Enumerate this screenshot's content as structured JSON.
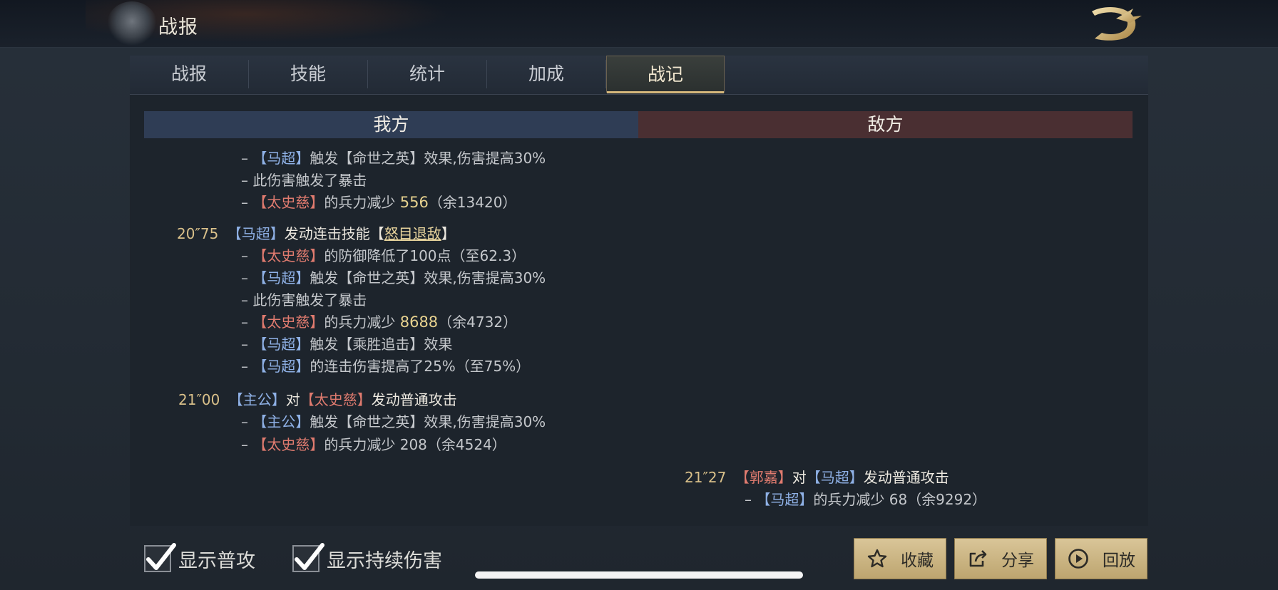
{
  "window": {
    "title": "战报"
  },
  "tabs": [
    {
      "label": "战报",
      "active": false
    },
    {
      "label": "技能",
      "active": false
    },
    {
      "label": "统计",
      "active": false
    },
    {
      "label": "加成",
      "active": false
    },
    {
      "label": "战记",
      "active": true
    }
  ],
  "sides": {
    "ours": "我方",
    "enemy": "敌方"
  },
  "log": {
    "partial": {
      "l1": {
        "dash": "–",
        "b1": "【马超】",
        "t1": "触发【命世之英】效果,伤害提高30%"
      },
      "l2": {
        "text": "– 此伤害触发了暴击"
      },
      "l3": {
        "dash": "–",
        "r1": "【太史慈】",
        "t1": "的兵力减少",
        "num": "556",
        "t2": "（余13420）"
      }
    },
    "e1": {
      "time": "20″75",
      "actor": "【马超】",
      "t1": "发动连击技能【",
      "skill": "怒目退敌",
      "t2": "】",
      "l1": {
        "dash": "–",
        "r1": "【太史慈】",
        "t1": "的防御降低了100点（至62.3）"
      },
      "l2": {
        "dash": "–",
        "b1": "【马超】",
        "t1": "触发【命世之英】效果,伤害提高30%"
      },
      "l3": {
        "text": "– 此伤害触发了暴击"
      },
      "l4": {
        "dash": "–",
        "r1": "【太史慈】",
        "t1": "的兵力减少",
        "num": "8688",
        "t2": "（余4732）"
      },
      "l5": {
        "dash": "–",
        "b1": "【马超】",
        "t1": "触发【乘胜追击】效果"
      },
      "l6": {
        "dash": "–",
        "b1": "【马超】",
        "t1": "的连击伤害提高了25%（至75%）"
      }
    },
    "e2": {
      "time": "21″00",
      "actor": "【主公】",
      "t1": "对",
      "target": "【太史慈】",
      "t2": "发动普通攻击",
      "l1": {
        "dash": "–",
        "b1": "【主公】",
        "t1": "触发【命世之英】效果,伤害提高30%"
      },
      "l2": {
        "dash": "–",
        "r1": "【太史慈】",
        "t1": "的兵力减少 208（余4524）"
      }
    },
    "e3": {
      "time": "21″27",
      "actor": "【郭嘉】",
      "t1": "对",
      "target": "【马超】",
      "t2": "发动普通攻击",
      "l1": {
        "dash": "–",
        "b1": "【马超】",
        "t1": "的兵力减少 68（余9292）"
      }
    }
  },
  "filters": [
    {
      "label": "显示普攻",
      "checked": true
    },
    {
      "label": "显示持续伤害",
      "checked": true
    }
  ],
  "actions": {
    "favorite": {
      "label": "收藏",
      "icon": "star-icon"
    },
    "share": {
      "label": "分享",
      "icon": "share-icon"
    },
    "replay": {
      "label": "回放",
      "icon": "play-icon"
    }
  },
  "colors": {
    "ally_name": "#8fb1e6",
    "enemy_name": "#e07b6f",
    "accent_gold": "#d5b77b"
  }
}
